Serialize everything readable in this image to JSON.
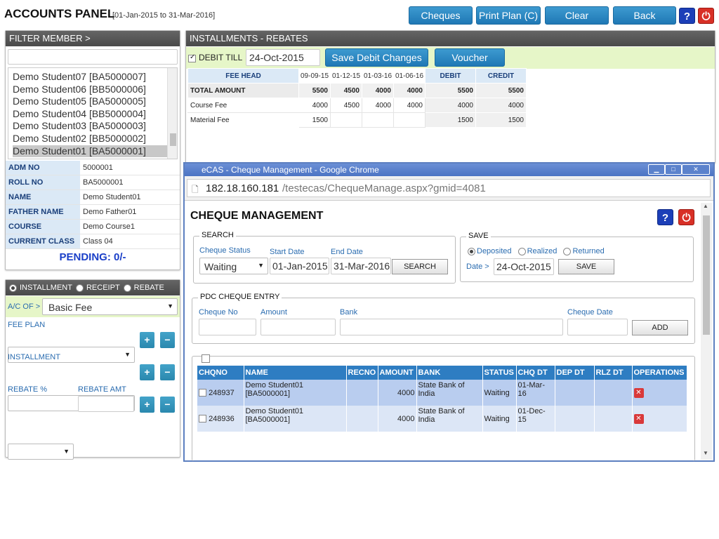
{
  "header": {
    "title": "ACCOUNTS PANEL",
    "range": "[01-Jan-2015 to 31-Mar-2016]",
    "buttons": {
      "cheques": "Cheques",
      "print_plan": "Print Plan (C)",
      "clear": "Clear",
      "back": "Back"
    },
    "help": "?",
    "power": "⏻"
  },
  "filter": {
    "title": "FILTER MEMBER >",
    "search_value": "",
    "list": [
      "Demo Student07 [BA5000007]",
      "Demo Student06 [BB5000006]",
      "Demo Student05 [BA5000005]",
      "Demo Student04 [BB5000004]",
      "Demo Student03 [BA5000003]",
      "Demo Student02 [BB5000002]",
      "Demo Student01 [BA5000001]"
    ],
    "info": [
      {
        "k": "ADM NO",
        "v": "5000001"
      },
      {
        "k": "ROLL NO",
        "v": "BA5000001"
      },
      {
        "k": "NAME",
        "v": "Demo Student01"
      },
      {
        "k": "FATHER NAME",
        "v": "Demo Father01"
      },
      {
        "k": "COURSE",
        "v": "Demo Course1"
      },
      {
        "k": "CURRENT CLASS",
        "v": "Class 04"
      }
    ],
    "pending": "PENDING: 0/-"
  },
  "entry": {
    "radios": [
      "INSTALLMENT",
      "RECEIPT",
      "REBATE"
    ],
    "ac_of": "A/C OF >",
    "ac_value": "Basic Fee",
    "fee_plan": "FEE PLAN",
    "installment": "INSTALLMENT",
    "rebate_pct": "REBATE %",
    "rebate_amt": "REBATE AMT"
  },
  "installments": {
    "title": "INSTALLMENTS - REBATES",
    "debit_till": "DEBIT TILL",
    "date": "24-Oct-2015",
    "save_btn": "Save Debit Changes",
    "voucher_btn": "Voucher",
    "headers": [
      "FEE HEAD",
      "09-09-15",
      "01-12-15",
      "01-03-16",
      "01-06-16",
      "DEBIT",
      "CREDIT"
    ],
    "rows": [
      [
        "TOTAL AMOUNT",
        "5500",
        "4500",
        "4000",
        "4000",
        "5500",
        "5500"
      ],
      [
        "Course Fee",
        "4000",
        "4500",
        "4000",
        "4000",
        "4000",
        "4000"
      ],
      [
        "Material Fee",
        "1500",
        "",
        "",
        "",
        "1500",
        "1500"
      ]
    ]
  },
  "popup": {
    "window_title": "eCAS - Cheque Management - Google Chrome",
    "url_host": "182.18.160.181",
    "url_path": "/testecas/ChequeManage.aspx?gmid=4081",
    "heading": "CHEQUE MANAGEMENT",
    "search": {
      "legend": "SEARCH",
      "status_label": "Cheque Status",
      "status_value": "Waiting",
      "start_label": "Start Date",
      "start_value": "01-Jan-2015",
      "end_label": "End Date",
      "end_value": "31-Mar-2016",
      "btn": "SEARCH"
    },
    "save": {
      "legend": "SAVE",
      "options": [
        "Deposited",
        "Realized",
        "Returned"
      ],
      "date_label": "Date >",
      "date_value": "24-Oct-2015",
      "btn": "SAVE"
    },
    "pdc": {
      "legend": "PDC CHEQUE ENTRY",
      "cheque_no": "Cheque No",
      "amount": "Amount",
      "bank": "Bank",
      "cheque_date": "Cheque Date",
      "btn": "ADD"
    },
    "table": {
      "headers": [
        "CHQNO",
        "NAME",
        "RECNO",
        "AMOUNT",
        "BANK",
        "STATUS",
        "CHQ DT",
        "DEP DT",
        "RLZ DT",
        "OPERATIONS"
      ],
      "rows": [
        {
          "chqno": "248937",
          "name": "Demo Student01 [BA5000001]",
          "recno": "",
          "amount": "4000",
          "bank": "State Bank of India",
          "status": "Waiting",
          "chqdt": "01-Mar-16",
          "depdt": "",
          "rlzdt": ""
        },
        {
          "chqno": "248936",
          "name": "Demo Student01 [BA5000001]",
          "recno": "",
          "amount": "4000",
          "bank": "State Bank of India",
          "status": "Waiting",
          "chqdt": "01-Dec-15",
          "depdt": "",
          "rlzdt": ""
        }
      ]
    }
  }
}
